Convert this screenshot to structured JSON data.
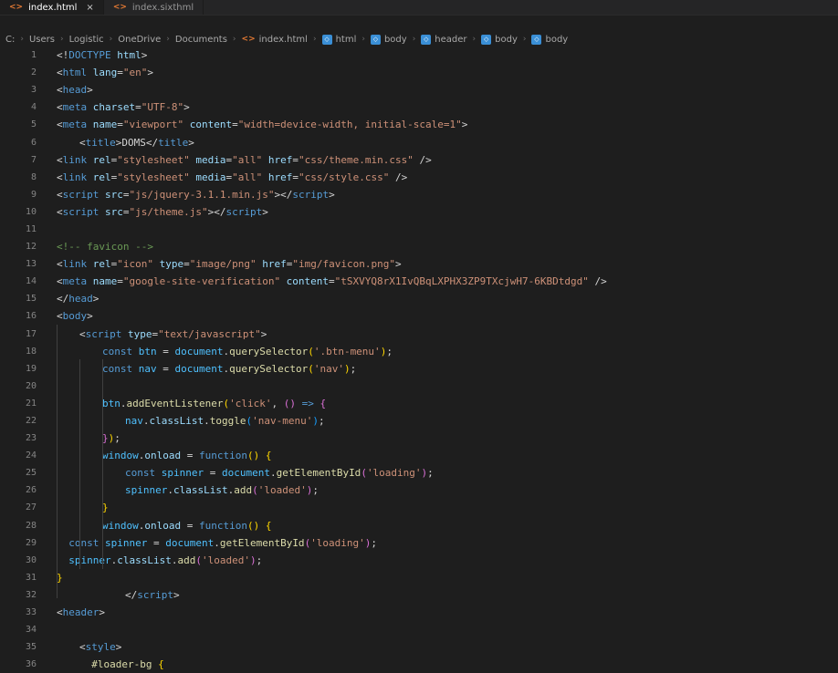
{
  "tabs": [
    {
      "label": "index.html",
      "active": true,
      "modified": true
    },
    {
      "label": "index.sixthml",
      "active": false,
      "modified": false
    }
  ],
  "breadcrumb": [
    {
      "label": "C:",
      "icon": "none"
    },
    {
      "label": "Users",
      "icon": "none"
    },
    {
      "label": "Logistic",
      "icon": "none"
    },
    {
      "label": "OneDrive",
      "icon": "none"
    },
    {
      "label": "Documents",
      "icon": "none"
    },
    {
      "label": "index.html",
      "icon": "html-file-icon"
    },
    {
      "label": "html",
      "icon": "tag-icon"
    },
    {
      "label": "body",
      "icon": "tag-icon"
    },
    {
      "label": "header",
      "icon": "tag-icon"
    },
    {
      "label": "body",
      "icon": "tag-icon"
    },
    {
      "label": "body",
      "icon": "tag-icon"
    }
  ],
  "code_lines": [
    {
      "n": "1",
      "indent": 0,
      "tokens": [
        [
          "t-punc",
          "<!"
        ],
        [
          "t-tag",
          "DOCTYPE"
        ],
        [
          "t-attr",
          " html"
        ],
        [
          "t-punc",
          ">"
        ]
      ]
    },
    {
      "n": "2",
      "indent": 0,
      "tokens": [
        [
          "t-punc",
          "<"
        ],
        [
          "t-tag",
          "html"
        ],
        [
          "t-attr",
          " lang"
        ],
        [
          "t-punc",
          "="
        ],
        [
          "t-str",
          "\"en\""
        ],
        [
          "t-punc",
          ">"
        ]
      ]
    },
    {
      "n": "3",
      "indent": 0,
      "tokens": [
        [
          "t-punc",
          "<"
        ],
        [
          "t-tag",
          "head"
        ],
        [
          "t-punc",
          ">"
        ]
      ]
    },
    {
      "n": "4",
      "indent": 0,
      "tokens": [
        [
          "t-punc",
          "<"
        ],
        [
          "t-tag",
          "meta"
        ],
        [
          "t-attr",
          " charset"
        ],
        [
          "t-punc",
          "="
        ],
        [
          "t-str",
          "\"UTF-8\""
        ],
        [
          "t-punc",
          ">"
        ]
      ]
    },
    {
      "n": "5",
      "indent": 0,
      "tokens": [
        [
          "t-punc",
          "<"
        ],
        [
          "t-tag",
          "meta"
        ],
        [
          "t-attr",
          " name"
        ],
        [
          "t-punc",
          "="
        ],
        [
          "t-str",
          "\"viewport\""
        ],
        [
          "t-attr",
          " content"
        ],
        [
          "t-punc",
          "="
        ],
        [
          "t-str",
          "\"width=device-width, initial-scale=1\""
        ],
        [
          "t-punc",
          ">"
        ]
      ]
    },
    {
      "n": "6",
      "indent": 1,
      "tokens": [
        [
          "t-punc",
          "<"
        ],
        [
          "t-tag",
          "title"
        ],
        [
          "t-punc",
          ">"
        ],
        [
          "t-txt",
          "DOMS"
        ],
        [
          "t-punc",
          "</"
        ],
        [
          "t-tag",
          "title"
        ],
        [
          "t-punc",
          ">"
        ]
      ]
    },
    {
      "n": "7",
      "indent": 0,
      "tokens": [
        [
          "t-punc",
          "<"
        ],
        [
          "t-tag",
          "link"
        ],
        [
          "t-attr",
          " rel"
        ],
        [
          "t-punc",
          "="
        ],
        [
          "t-str",
          "\"stylesheet\""
        ],
        [
          "t-attr",
          " media"
        ],
        [
          "t-punc",
          "="
        ],
        [
          "t-str",
          "\"all\""
        ],
        [
          "t-attr",
          " href"
        ],
        [
          "t-punc",
          "="
        ],
        [
          "t-str",
          "\"css/theme.min.css\""
        ],
        [
          "t-punc",
          " />"
        ]
      ]
    },
    {
      "n": "8",
      "indent": 0,
      "tokens": [
        [
          "t-punc",
          "<"
        ],
        [
          "t-tag",
          "link"
        ],
        [
          "t-attr",
          " rel"
        ],
        [
          "t-punc",
          "="
        ],
        [
          "t-str",
          "\"stylesheet\""
        ],
        [
          "t-attr",
          " media"
        ],
        [
          "t-punc",
          "="
        ],
        [
          "t-str",
          "\"all\""
        ],
        [
          "t-attr",
          " href"
        ],
        [
          "t-punc",
          "="
        ],
        [
          "t-str",
          "\"css/style.css\""
        ],
        [
          "t-punc",
          " />"
        ]
      ]
    },
    {
      "n": "9",
      "indent": 0,
      "tokens": [
        [
          "t-punc",
          "<"
        ],
        [
          "t-tag",
          "script"
        ],
        [
          "t-attr",
          " src"
        ],
        [
          "t-punc",
          "="
        ],
        [
          "t-str",
          "\"js/jquery-3.1.1.min.js\""
        ],
        [
          "t-punc",
          "></"
        ],
        [
          "t-tag",
          "script"
        ],
        [
          "t-punc",
          ">"
        ]
      ]
    },
    {
      "n": "10",
      "indent": 0,
      "tokens": [
        [
          "t-punc",
          "<"
        ],
        [
          "t-tag",
          "script"
        ],
        [
          "t-attr",
          " src"
        ],
        [
          "t-punc",
          "="
        ],
        [
          "t-str",
          "\"js/theme.js\""
        ],
        [
          "t-punc",
          "></"
        ],
        [
          "t-tag",
          "script"
        ],
        [
          "t-punc",
          ">"
        ]
      ]
    },
    {
      "n": "11",
      "indent": 0,
      "tokens": []
    },
    {
      "n": "12",
      "indent": 0,
      "tokens": [
        [
          "t-cmt",
          "<!-- favicon -->"
        ]
      ]
    },
    {
      "n": "13",
      "indent": 0,
      "tokens": [
        [
          "t-punc",
          "<"
        ],
        [
          "t-tag",
          "link"
        ],
        [
          "t-attr",
          " rel"
        ],
        [
          "t-punc",
          "="
        ],
        [
          "t-str",
          "\"icon\""
        ],
        [
          "t-attr",
          " type"
        ],
        [
          "t-punc",
          "="
        ],
        [
          "t-str",
          "\"image/png\""
        ],
        [
          "t-attr",
          " href"
        ],
        [
          "t-punc",
          "="
        ],
        [
          "t-str",
          "\"img/favicon.png\""
        ],
        [
          "t-punc",
          ">"
        ]
      ]
    },
    {
      "n": "14",
      "indent": 0,
      "tokens": [
        [
          "t-punc",
          "<"
        ],
        [
          "t-tag",
          "meta"
        ],
        [
          "t-attr",
          " name"
        ],
        [
          "t-punc",
          "="
        ],
        [
          "t-str",
          "\"google-site-verification\""
        ],
        [
          "t-attr",
          " content"
        ],
        [
          "t-punc",
          "="
        ],
        [
          "t-str",
          "\"tSXVYQ8rX1IvQBqLXPHX3ZP9TXcjwH7-6KBDtdgd\""
        ],
        [
          "t-punc",
          " />"
        ]
      ]
    },
    {
      "n": "15",
      "indent": 0,
      "tokens": [
        [
          "t-punc",
          "</"
        ],
        [
          "t-tag",
          "head"
        ],
        [
          "t-punc",
          ">"
        ]
      ]
    },
    {
      "n": "16",
      "indent": 0,
      "tokens": [
        [
          "t-punc",
          "<"
        ],
        [
          "t-tag",
          "body"
        ],
        [
          "t-punc",
          ">"
        ]
      ]
    },
    {
      "n": "17",
      "indent": 1,
      "tokens": [
        [
          "t-punc",
          "<"
        ],
        [
          "t-tag",
          "script"
        ],
        [
          "t-attr",
          " type"
        ],
        [
          "t-punc",
          "="
        ],
        [
          "t-str",
          "\"text/javascript\""
        ],
        [
          "t-punc",
          ">"
        ]
      ]
    },
    {
      "n": "18",
      "indent": 2,
      "tokens": [
        [
          "t-kw",
          "const"
        ],
        [
          "t-var",
          " btn"
        ],
        [
          "t-punc",
          " = "
        ],
        [
          "t-var",
          "document"
        ],
        [
          "t-punc",
          "."
        ],
        [
          "t-fn",
          "querySelector"
        ],
        [
          "t-brk",
          "("
        ],
        [
          "t-str",
          "'.btn-menu'"
        ],
        [
          "t-brk",
          ")"
        ],
        [
          "t-punc",
          ";"
        ]
      ]
    },
    {
      "n": "19",
      "indent": 2,
      "tokens": [
        [
          "t-kw",
          "const"
        ],
        [
          "t-var",
          " nav"
        ],
        [
          "t-punc",
          " = "
        ],
        [
          "t-var",
          "document"
        ],
        [
          "t-punc",
          "."
        ],
        [
          "t-fn",
          "querySelector"
        ],
        [
          "t-brk",
          "("
        ],
        [
          "t-str",
          "'nav'"
        ],
        [
          "t-brk",
          ")"
        ],
        [
          "t-punc",
          ";"
        ]
      ]
    },
    {
      "n": "20",
      "indent": 2,
      "tokens": []
    },
    {
      "n": "21",
      "indent": 2,
      "tokens": [
        [
          "t-var",
          "btn"
        ],
        [
          "t-punc",
          "."
        ],
        [
          "t-fn",
          "addEventListener"
        ],
        [
          "t-brk",
          "("
        ],
        [
          "t-str",
          "'click'"
        ],
        [
          "t-punc",
          ", "
        ],
        [
          "t-brk2",
          "()"
        ],
        [
          "t-kw",
          " =>"
        ],
        [
          "t-punc",
          " "
        ],
        [
          "t-brk2",
          "{"
        ]
      ]
    },
    {
      "n": "22",
      "indent": 3,
      "tokens": [
        [
          "t-var",
          "nav"
        ],
        [
          "t-punc",
          "."
        ],
        [
          "t-attr",
          "classList"
        ],
        [
          "t-punc",
          "."
        ],
        [
          "t-fn",
          "toggle"
        ],
        [
          "t-brk3",
          "("
        ],
        [
          "t-str",
          "'nav-menu'"
        ],
        [
          "t-brk3",
          ")"
        ],
        [
          "t-punc",
          ";"
        ]
      ]
    },
    {
      "n": "23",
      "indent": 2,
      "tokens": [
        [
          "t-brk2",
          "}"
        ],
        [
          "t-brk",
          ")"
        ],
        [
          "t-punc",
          ";"
        ]
      ]
    },
    {
      "n": "24",
      "indent": 2,
      "tokens": [
        [
          "t-var",
          "window"
        ],
        [
          "t-punc",
          "."
        ],
        [
          "t-attr",
          "onload"
        ],
        [
          "t-punc",
          " = "
        ],
        [
          "t-kw",
          "function"
        ],
        [
          "t-brk",
          "()"
        ],
        [
          "t-punc",
          " "
        ],
        [
          "t-brk",
          "{"
        ]
      ]
    },
    {
      "n": "25",
      "indent": 3,
      "tokens": [
        [
          "t-kw",
          "const"
        ],
        [
          "t-var",
          " spinner"
        ],
        [
          "t-punc",
          " = "
        ],
        [
          "t-var",
          "document"
        ],
        [
          "t-punc",
          "."
        ],
        [
          "t-fn",
          "getElementById"
        ],
        [
          "t-brk2",
          "("
        ],
        [
          "t-str",
          "'loading'"
        ],
        [
          "t-brk2",
          ")"
        ],
        [
          "t-punc",
          ";"
        ]
      ]
    },
    {
      "n": "26",
      "indent": 3,
      "tokens": [
        [
          "t-var",
          "spinner"
        ],
        [
          "t-punc",
          "."
        ],
        [
          "t-attr",
          "classList"
        ],
        [
          "t-punc",
          "."
        ],
        [
          "t-fn",
          "add"
        ],
        [
          "t-brk2",
          "("
        ],
        [
          "t-str",
          "'loaded'"
        ],
        [
          "t-brk2",
          ")"
        ],
        [
          "t-punc",
          ";"
        ]
      ]
    },
    {
      "n": "27",
      "indent": 2,
      "tokens": [
        [
          "t-brk",
          "}"
        ]
      ]
    },
    {
      "n": "28",
      "indent": 2,
      "tokens": [
        [
          "t-var",
          "window"
        ],
        [
          "t-punc",
          "."
        ],
        [
          "t-attr",
          "onload"
        ],
        [
          "t-punc",
          " = "
        ],
        [
          "t-kw",
          "function"
        ],
        [
          "t-brk",
          "()"
        ],
        [
          "t-punc",
          " "
        ],
        [
          "t-brk",
          "{"
        ]
      ]
    },
    {
      "n": "29",
      "indent": 0,
      "tokens": [
        [
          "t-punc",
          "  "
        ],
        [
          "t-kw",
          "const"
        ],
        [
          "t-var",
          " spinner"
        ],
        [
          "t-punc",
          " = "
        ],
        [
          "t-var",
          "document"
        ],
        [
          "t-punc",
          "."
        ],
        [
          "t-fn",
          "getElementById"
        ],
        [
          "t-brk2",
          "("
        ],
        [
          "t-str",
          "'loading'"
        ],
        [
          "t-brk2",
          ")"
        ],
        [
          "t-punc",
          ";"
        ]
      ]
    },
    {
      "n": "30",
      "indent": 0,
      "tokens": [
        [
          "t-punc",
          "  "
        ],
        [
          "t-var",
          "spinner"
        ],
        [
          "t-punc",
          "."
        ],
        [
          "t-attr",
          "classList"
        ],
        [
          "t-punc",
          "."
        ],
        [
          "t-fn",
          "add"
        ],
        [
          "t-brk2",
          "("
        ],
        [
          "t-str",
          "'loaded'"
        ],
        [
          "t-brk2",
          ")"
        ],
        [
          "t-punc",
          ";"
        ]
      ]
    },
    {
      "n": "31",
      "indent": 0,
      "tokens": [
        [
          "t-brk",
          "}"
        ]
      ]
    },
    {
      "n": "32",
      "indent": 3,
      "tokens": [
        [
          "t-punc",
          "</"
        ],
        [
          "t-tag",
          "script"
        ],
        [
          "t-punc",
          ">"
        ]
      ]
    },
    {
      "n": "33",
      "indent": 0,
      "tokens": [
        [
          "t-punc",
          "<"
        ],
        [
          "t-tag",
          "header"
        ],
        [
          "t-punc",
          ">"
        ]
      ]
    },
    {
      "n": "34",
      "indent": 0,
      "tokens": []
    },
    {
      "n": "35",
      "indent": 1,
      "tokens": [
        [
          "t-punc",
          "<"
        ],
        [
          "t-tag",
          "style"
        ],
        [
          "t-punc",
          ">"
        ]
      ]
    },
    {
      "n": "36",
      "indent": 1,
      "tokens": [
        [
          "t-punc",
          "  "
        ],
        [
          "t-fn",
          "#loader-bg"
        ],
        [
          "t-punc",
          " "
        ],
        [
          "t-brk",
          "{"
        ]
      ]
    }
  ]
}
